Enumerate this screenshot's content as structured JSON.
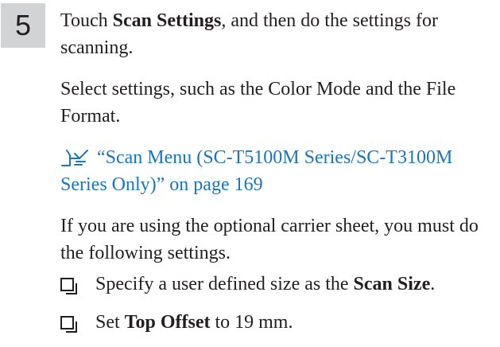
{
  "step": {
    "number": "5",
    "intro": {
      "prefix": "Touch ",
      "bold": "Scan Settings",
      "suffix": ", and then do the settings for scanning."
    },
    "para1": "Select settings, such as the Color Mode and the File Format.",
    "link": {
      "icon": "pointing-hand-icon",
      "text": "“Scan Menu (SC-T5100M Series/SC-T3100M Series Only)” on page 169",
      "color": "#1b75bc"
    },
    "para2": "If you are using the optional carrier sheet, you must do the following settings.",
    "bullets": [
      {
        "prefix": "Specify a user defined size as the ",
        "bold": "Scan Size",
        "suffix": "."
      },
      {
        "prefix": "Set ",
        "bold": "Top Offset",
        "suffix": " to 19 mm."
      }
    ]
  }
}
